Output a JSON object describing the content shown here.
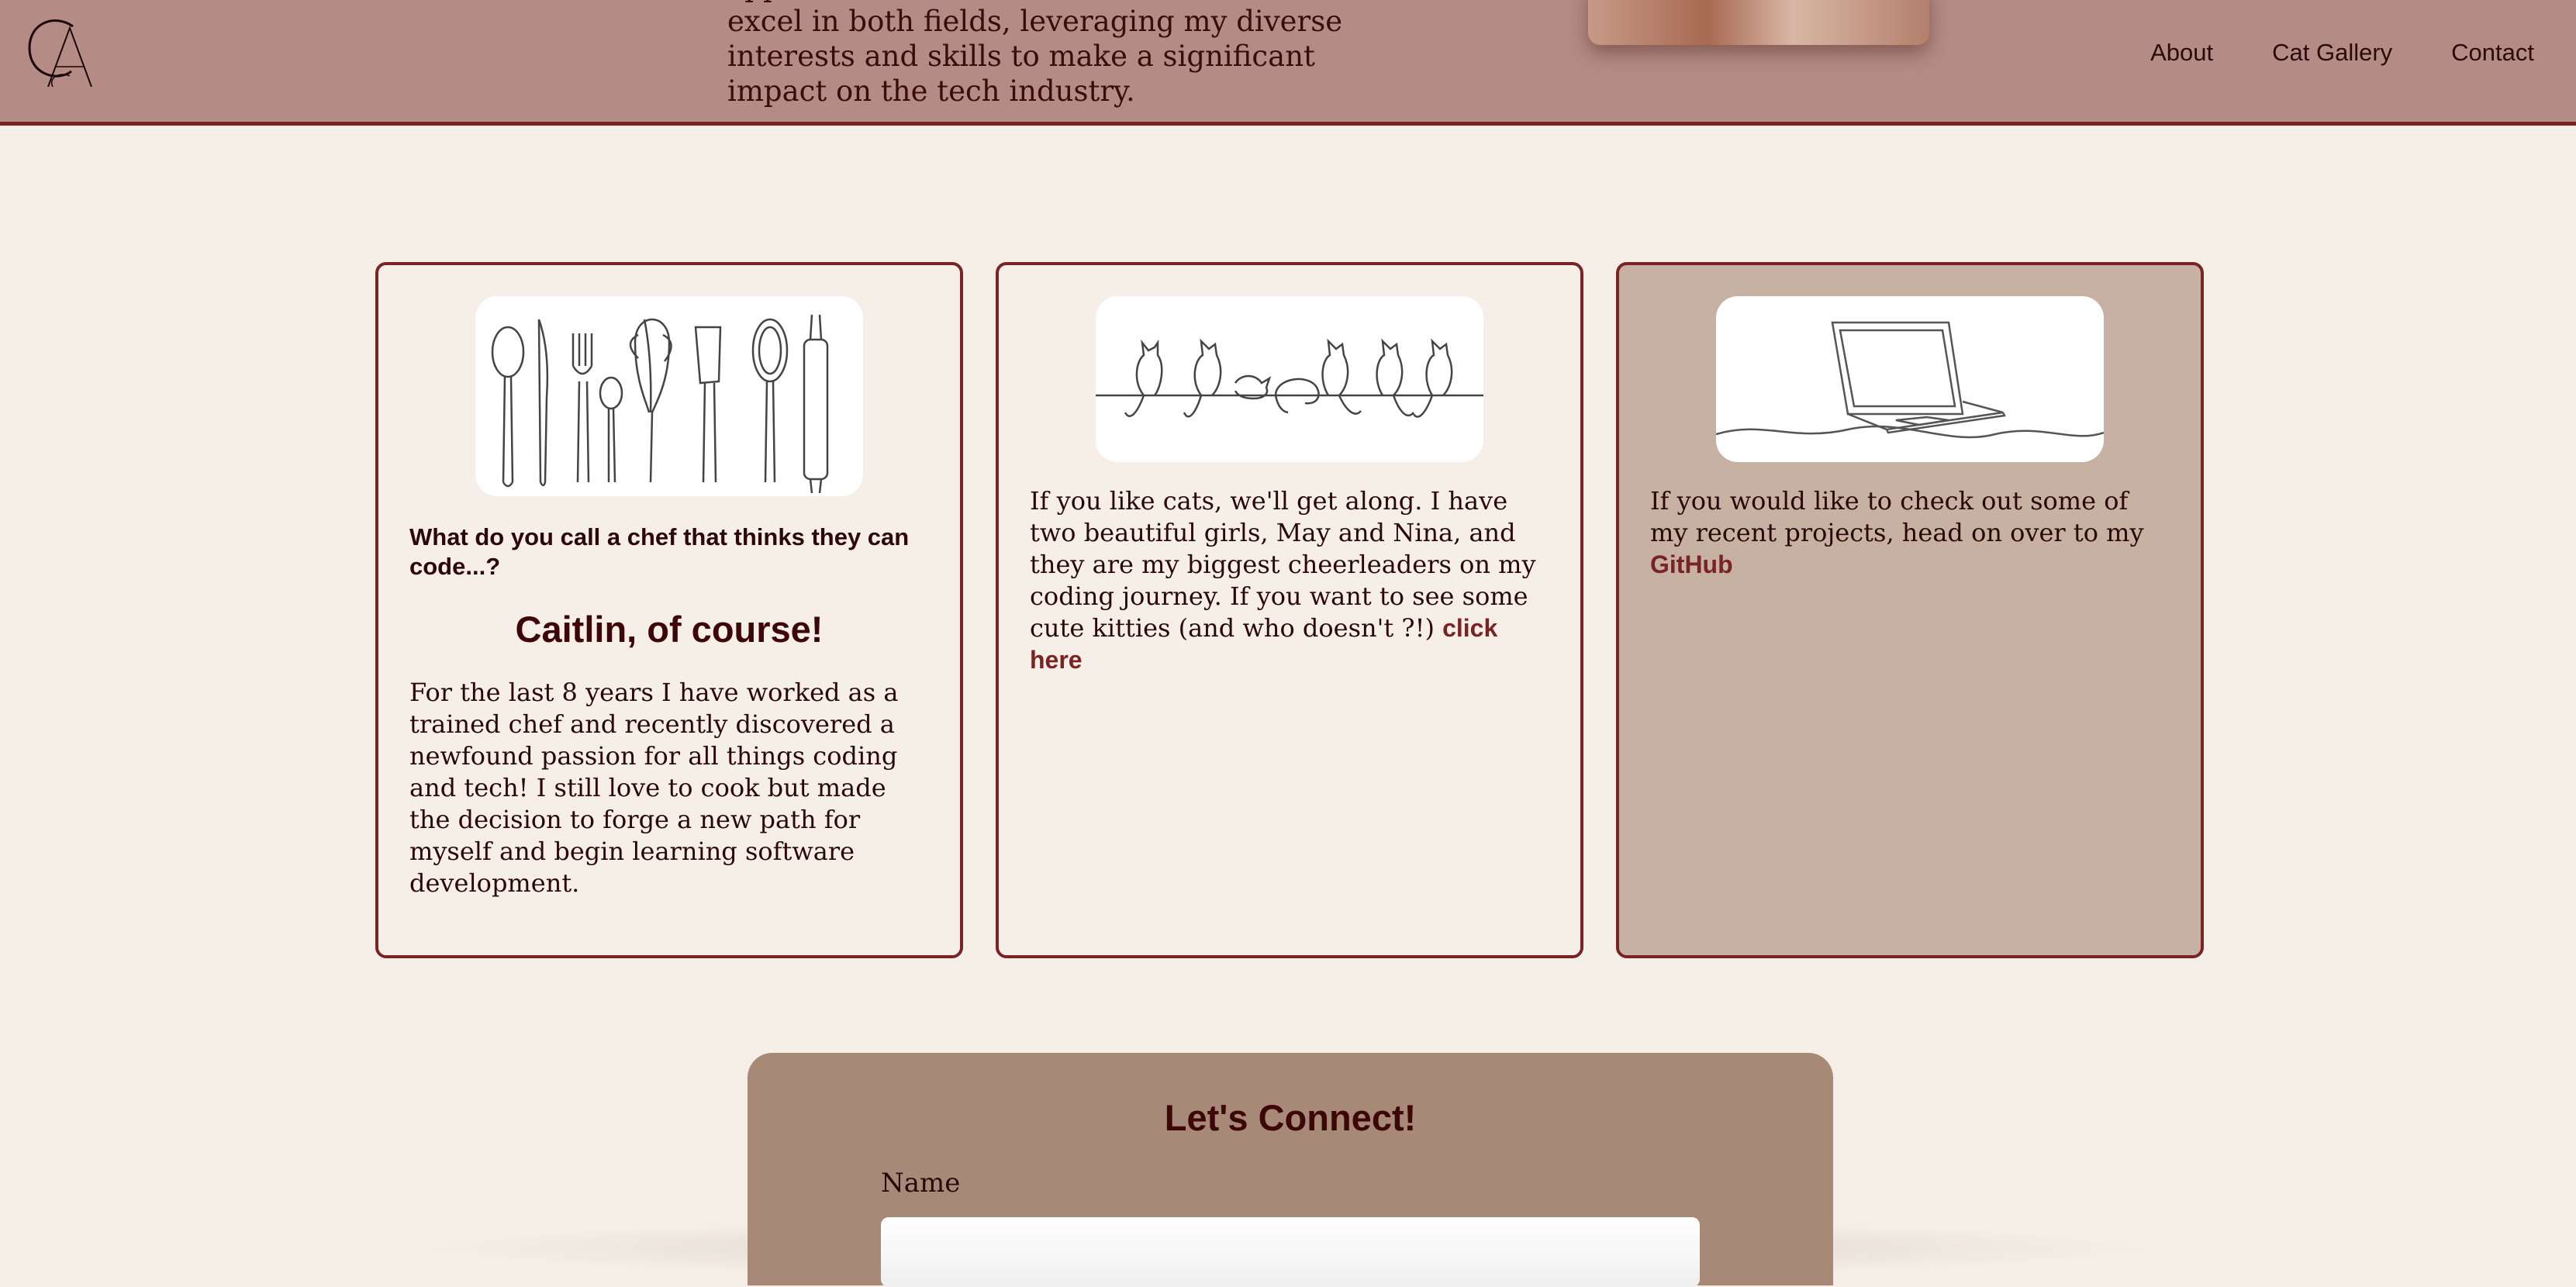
{
  "header": {
    "logo_alt": "CA",
    "hero_text": "opportunities in tech. I aim to innovate and excel in both fields, leveraging my diverse interests and skills to make a significant impact on the tech industry.",
    "nav": [
      {
        "label": "About"
      },
      {
        "label": "Cat Gallery"
      },
      {
        "label": "Contact"
      }
    ]
  },
  "cards": [
    {
      "image": "kitchen-utensils-line-art",
      "question": "What do you call a chef that thinks they can code...?",
      "answer": "Caitlin, of course!",
      "body": "For the last 8 years I have worked as a trained chef and recently discovered a newfound passion for all things coding and tech! I still love to cook but made the decision to forge a new path for myself and begin learning software development."
    },
    {
      "image": "cats-line-art",
      "body": "If you like cats, we'll get along. I have two beautiful girls, May and Nina, and they are my biggest cheerleaders on my coding journey. If you want to see some cute kitties (and who doesn't ?!)",
      "link_label": "click here"
    },
    {
      "image": "laptop-line-art",
      "body": "If you would like to check out some of my recent projects, head on over to my",
      "link_label": "GitHub"
    }
  ],
  "contact": {
    "title": "Let's Connect!",
    "name_label": "Name",
    "name_value": ""
  },
  "colors": {
    "background": "#f6efe7",
    "header": "#b58b85",
    "accent": "#7a2323",
    "card_tan": "#c6b1a2",
    "contact_panel": "#a68a77"
  }
}
